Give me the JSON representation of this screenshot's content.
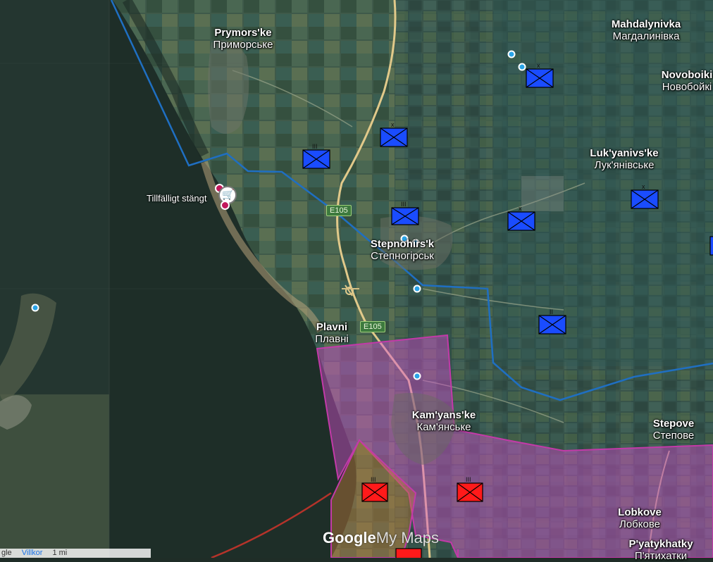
{
  "places": [
    {
      "id": "prymorske",
      "latin": "Prymors'ke",
      "cyr": "Приморське"
    },
    {
      "id": "mahdalynivka",
      "latin": "Mahdalynivka",
      "cyr": "Магдалинівка"
    },
    {
      "id": "novoboiki",
      "latin": "Novoboiki",
      "cyr": "Новобойкі"
    },
    {
      "id": "lukyanivske",
      "latin": "Luk'yanivs'ke",
      "cyr": "Лук'янівське"
    },
    {
      "id": "stepnohirsk",
      "latin": "Stepnohirs'k",
      "cyr": "Степногірськ"
    },
    {
      "id": "plavni",
      "latin": "Plavni",
      "cyr": "Плавні"
    },
    {
      "id": "kamianske",
      "latin": "Kam'yans'ke",
      "cyr": "Кам'янське"
    },
    {
      "id": "stepove",
      "latin": "Stepove",
      "cyr": "Степове"
    },
    {
      "id": "lobkove",
      "latin": "Lobkove",
      "cyr": "Лобкове"
    },
    {
      "id": "pyatykhatky",
      "latin": "P'yatykhatky",
      "cyr": "П'ятихатки"
    }
  ],
  "roads": [
    {
      "id": "e105-north",
      "label": "E105"
    },
    {
      "id": "e105-south",
      "label": "E105"
    }
  ],
  "poi": {
    "closed_label": "Tillfälligt stängt",
    "icon": "shopping-cart-icon"
  },
  "branding": {
    "google": "Google",
    "mymaps": "My Maps"
  },
  "footer": {
    "data": "gle",
    "terms": "Villkor",
    "scale": "1 mi"
  },
  "colors": {
    "ukraine_unit": "#1a4cff",
    "russia_unit": "#ff1a1a",
    "front_line": "#1f6fc2",
    "occupied_fill": "#d64fd0",
    "occupied_border": "#c23aa8"
  },
  "units": {
    "blue": [
      {
        "echelon": "x"
      },
      {
        "echelon": "x"
      },
      {
        "echelon": "III"
      },
      {
        "echelon": "III"
      },
      {
        "echelon": "x"
      },
      {
        "echelon": "x"
      },
      {
        "echelon": "x"
      },
      {
        "echelon": "II"
      }
    ],
    "red": [
      {
        "echelon": "III"
      },
      {
        "echelon": "III"
      }
    ]
  }
}
